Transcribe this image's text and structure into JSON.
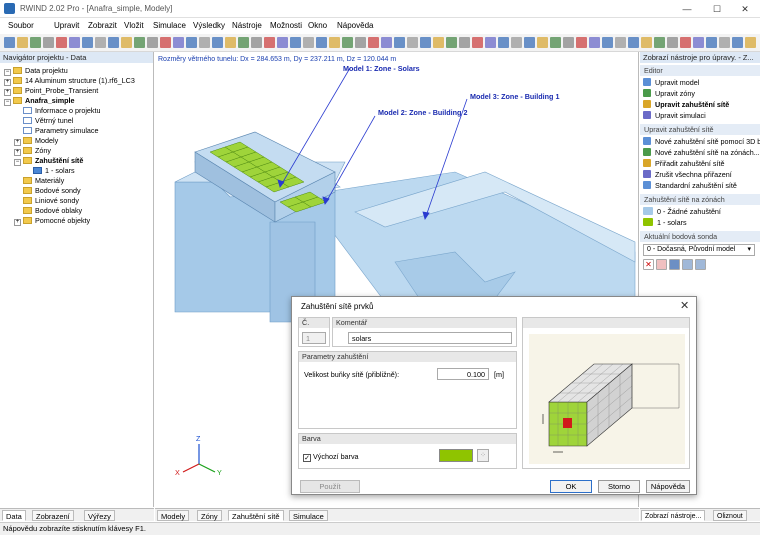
{
  "window": {
    "title": "RWIND 2.02 Pro - [Anafra_simple, Modely]",
    "min": "—",
    "max": "☐",
    "close": "✕"
  },
  "menu": [
    "Soubor",
    "Upravit",
    "Zobrazit",
    "Vložit",
    "Simulace",
    "Výsledky",
    "Nástroje",
    "Možnosti",
    "Okno",
    "Nápověda"
  ],
  "navigator": {
    "title": "Navigátor projektu - Data",
    "items": [
      {
        "label": "Data projektu",
        "level": 0,
        "exp": "−",
        "icon": "folder",
        "bold": false
      },
      {
        "label": "14 Aluminum structure (1).rf6_LC3",
        "level": 0,
        "exp": "+",
        "icon": "folder",
        "bold": false
      },
      {
        "label": "Point_Probe_Transient",
        "level": 0,
        "exp": "+",
        "icon": "folder",
        "bold": false
      },
      {
        "label": "Anafra_simple",
        "level": 0,
        "exp": "−",
        "icon": "folder",
        "bold": true
      },
      {
        "label": "Informace o projektu",
        "level": 1,
        "exp": "",
        "icon": "doc",
        "bold": false
      },
      {
        "label": "Větrný tunel",
        "level": 1,
        "exp": "",
        "icon": "doc",
        "bold": false
      },
      {
        "label": "Parametry simulace",
        "level": 1,
        "exp": "",
        "icon": "doc",
        "bold": false
      },
      {
        "label": "Modely",
        "level": 1,
        "exp": "+",
        "icon": "folder",
        "bold": false
      },
      {
        "label": "Zóny",
        "level": 1,
        "exp": "+",
        "icon": "folder",
        "bold": false
      },
      {
        "label": "Zahuštění sítě",
        "level": 1,
        "exp": "−",
        "icon": "folder",
        "bold": true
      },
      {
        "label": "1 - solars",
        "level": 2,
        "exp": "",
        "icon": "blue",
        "bold": false
      },
      {
        "label": "Materiály",
        "level": 1,
        "exp": "",
        "icon": "folder",
        "bold": false
      },
      {
        "label": "Bodové sondy",
        "level": 1,
        "exp": "",
        "icon": "folder",
        "bold": false
      },
      {
        "label": "Liniové sondy",
        "level": 1,
        "exp": "",
        "icon": "folder",
        "bold": false
      },
      {
        "label": "Bodové oblaky",
        "level": 1,
        "exp": "",
        "icon": "folder",
        "bold": false
      },
      {
        "label": "Pomocné objekty",
        "level": 1,
        "exp": "+",
        "icon": "folder",
        "bold": false
      }
    ],
    "tabs": [
      "Data",
      "Zobrazení",
      "Výřezy"
    ]
  },
  "viewport": {
    "info": "Rozměry větrného tunelu: Dx = 284.653 m, Dy = 237.211 m, Dz = 120.044 m",
    "labels": [
      "Model 1: Zone - Solars",
      "Model 2: Zone - Building 2",
      "Model 3: Zone - Building 1"
    ],
    "axes": {
      "x": "X",
      "y": "Y",
      "z": "Z"
    },
    "tabs": [
      "Modely",
      "Zóny",
      "Zahuštění sítě",
      "Simulace"
    ]
  },
  "right_panel": {
    "title": "Zobrazí nástroje pro úpravy. - Z...",
    "sections": [
      {
        "title": "Editor",
        "items": [
          "Upravit model",
          "Upravit zóny",
          "Upravit zahuštění sítě",
          "Upravit simulaci"
        ]
      },
      {
        "title": "Upravit zahuštění sítě",
        "items": [
          "Nové zahuštění sítě pomocí 3D bl...",
          "Nové zahuštění sítě na zónách...",
          "Přiřadit zahuštění sítě",
          "Zrušit všechna přiřazení",
          "Standardní zahuštění sítě"
        ]
      },
      {
        "title": "Zahuštění sítě na zónách",
        "items": [
          "0 - Žádné zahuštění",
          "1 - solars"
        ]
      },
      {
        "title": "Aktuální bodová sonda",
        "items": []
      }
    ],
    "probe_select": "0 - Dočasná, Původní model",
    "tabs": [
      "Zobrazí nástroje...",
      "Oliznout"
    ]
  },
  "dialog": {
    "title": "Zahuštění sítě prvků",
    "no_label": "Č.",
    "no_value": "1",
    "comment_label": "Komentář",
    "comment_value": "solars",
    "params_header": "Parametry zahuštění",
    "cell_size_label": "Velikost buňky sítě (přibližně):",
    "cell_size_value": "0.100",
    "cell_size_unit": "[m]",
    "color_header": "Barva",
    "default_color_label": "Výchozí barva",
    "color_swatch": "#8fc400",
    "buttons": {
      "use": "Použít",
      "ok": "OK",
      "cancel": "Storno",
      "help": "Nápověda"
    }
  },
  "status": "Nápovědu zobrazíte stisknutím klávesy F1."
}
